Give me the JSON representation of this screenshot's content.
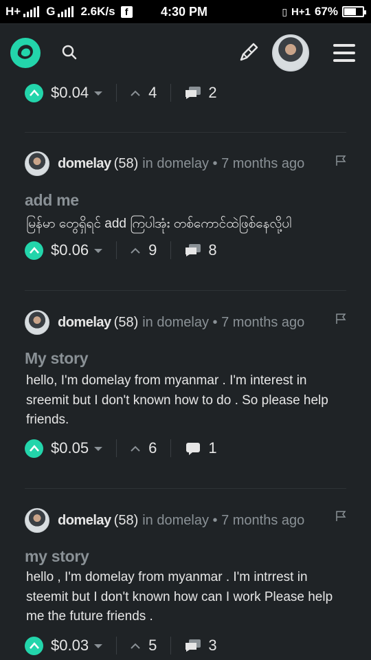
{
  "status_bar": {
    "net1": "H+",
    "net2": "G",
    "speed": "2.6K/s",
    "fb_icon": "f",
    "time": "4:30 PM",
    "right_net": "H+1",
    "battery_pct": "67%",
    "battery_level": 0.67
  },
  "header": {
    "logo_icon": "steemit-logo-icon",
    "search_icon": "search-icon",
    "edit_icon": "pencil-icon",
    "menu_icon": "hamburger-icon"
  },
  "colors": {
    "accent": "#23d5ab",
    "background": "#1f2326",
    "muted": "#8a9196"
  },
  "top_actions": {
    "payout": "$0.04",
    "votes": "4",
    "comments": "2"
  },
  "posts": [
    {
      "author": "domelay",
      "rep": "(58)",
      "meta": "in domelay • 7 months ago",
      "title": "add me",
      "body": "မြန်မာ တွေရှိရင် add ကြပါအုံး တစ်ကောင်ထဲဖြစ်နေလို့ပါ",
      "payout": "$0.06",
      "votes": "9",
      "comments": "8"
    },
    {
      "author": "domelay",
      "rep": "(58)",
      "meta": "in domelay • 7 months ago",
      "title": "My story",
      "body": "hello, I'm domelay from myanmar . I'm interest in sreemit but I don't known how to do . So please help friends.",
      "payout": "$0.05",
      "votes": "6",
      "comments": "1"
    },
    {
      "author": "domelay",
      "rep": "(58)",
      "meta": "in domelay • 7 months ago",
      "title": "my story",
      "body": "hello , I'm domelay from myanmar . I'm intrrest in steemit but I don't known how can I work Please help me the future friends .",
      "payout": "$0.03",
      "votes": "5",
      "comments": "3"
    }
  ]
}
